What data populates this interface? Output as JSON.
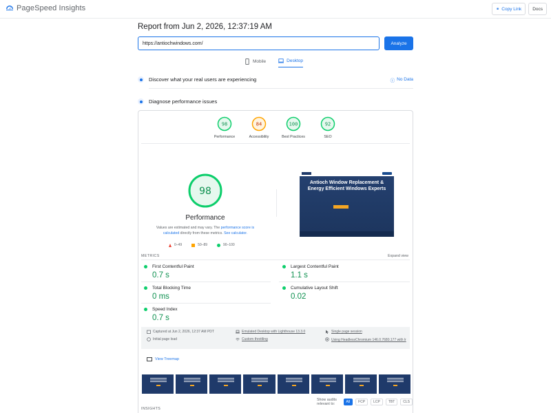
{
  "header": {
    "app_title": "PageSpeed Insights",
    "copy_link": "Copy Link",
    "docs": "Docs"
  },
  "report": {
    "title": "Report from Jun 2, 2026, 12:37:19 AM",
    "url_value": "https://antiochwindows.com/",
    "analyze_label": "Analyze"
  },
  "device_tabs": [
    {
      "label": "Mobile",
      "active": false
    },
    {
      "label": "Desktop",
      "active": true
    }
  ],
  "sections": {
    "real_users": "Discover what your real users are experiencing",
    "no_data": "No Data",
    "diagnose": "Diagnose performance issues"
  },
  "categories": [
    {
      "label": "Performance",
      "score": "98",
      "color": "#0cce6b"
    },
    {
      "label": "Accessibility",
      "score": "84",
      "color": "#ffa400"
    },
    {
      "label": "Best Practices",
      "score": "100",
      "color": "#0cce6b"
    },
    {
      "label": "SEO",
      "score": "92",
      "color": "#0cce6b"
    }
  ],
  "performance": {
    "score": "98",
    "title": "Performance",
    "note_1": "Values are estimated and may vary. The ",
    "note_link_1": "performance score is calculated",
    "note_2": " directly from these metrics. ",
    "note_link_2": "See calculator.",
    "legend": [
      {
        "label": "0–49",
        "shape": "triangle",
        "color": "#eb4335"
      },
      {
        "label": "50–89",
        "shape": "square",
        "color": "#ffa400"
      },
      {
        "label": "90–100",
        "shape": "circle",
        "color": "#0cce6b"
      }
    ]
  },
  "preview": {
    "headline": "Antioch Window Replacement & Energy Efficient Windows Experts"
  },
  "metrics": {
    "label": "METRICS",
    "expand": "Expand view",
    "items": [
      {
        "name": "First Contentful Paint",
        "value": "0.7 s"
      },
      {
        "name": "Largest Contentful Paint",
        "value": "1.1 s"
      },
      {
        "name": "Total Blocking Time",
        "value": "0 ms"
      },
      {
        "name": "Cumulative Layout Shift",
        "value": "0.02"
      },
      {
        "name": "Speed Index",
        "value": "0.7 s"
      }
    ]
  },
  "run_info": {
    "captured": "Captured at Jun 2, 2026, 12:37 AM PDT",
    "initial_load": "Initial page load",
    "emulated": "Emulated Desktop with Lighthouse 13.3.0",
    "throttling": "Custom throttling",
    "session": "Single page session",
    "browser": "Using HeadlessChromium 146.0.7680.177 with lr"
  },
  "treemap": "View Treemap",
  "audits": {
    "label": "Show audits relevant to:",
    "chips": [
      "All",
      "FCP",
      "LCP",
      "TBT",
      "CLS"
    ]
  },
  "insights_label": "INSIGHTS"
}
